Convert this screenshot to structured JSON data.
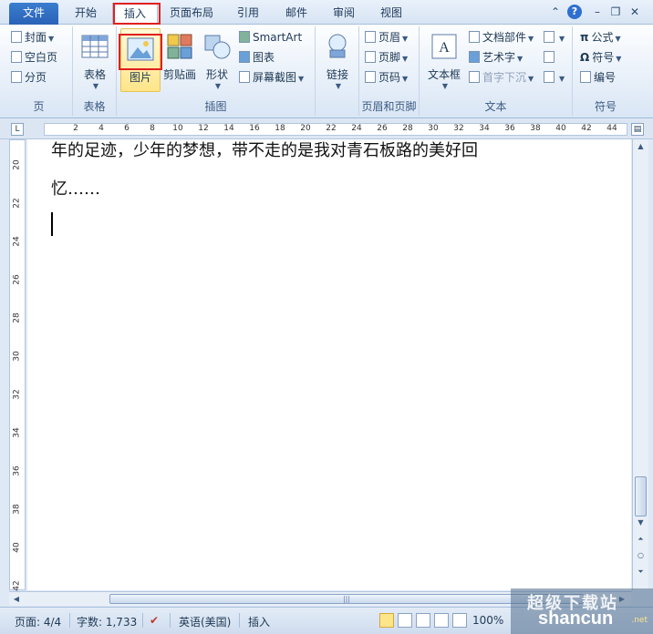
{
  "tabs": [
    {
      "label": "文件"
    },
    {
      "label": "开始"
    },
    {
      "label": "插入"
    },
    {
      "label": "页面布局"
    },
    {
      "label": "引用"
    },
    {
      "label": "邮件"
    },
    {
      "label": "审阅"
    },
    {
      "label": "视图"
    }
  ],
  "window_controls": {
    "help": "?"
  },
  "ribbon": {
    "pages": {
      "label": "页",
      "items": [
        "封面",
        "空白页",
        "分页"
      ]
    },
    "tables": {
      "label": "表格",
      "button": "表格"
    },
    "illustrations": {
      "label": "插图",
      "picture": "图片",
      "clipart": "剪贴画",
      "shapes": "形状",
      "smartart": "SmartArt",
      "chart": "图表",
      "screenshot": "屏幕截图"
    },
    "links": {
      "label": "",
      "button": "链接"
    },
    "header_footer": {
      "label": "页眉和页脚",
      "items": [
        "页眉",
        "页脚",
        "页码"
      ]
    },
    "text": {
      "label": "文本",
      "textbox": "文本框",
      "quickparts": "文档部件",
      "wordart": "艺术字",
      "dropcap": "首字下沉"
    },
    "symbols": {
      "label": "符号",
      "items": [
        "公式",
        "符号",
        "编号"
      ]
    }
  },
  "ruler": {
    "numbers": [
      "2",
      "4",
      "6",
      "8",
      "10",
      "12",
      "14",
      "16",
      "18",
      "20",
      "22",
      "24",
      "26",
      "28",
      "30",
      "32",
      "34",
      "36",
      "38",
      "40",
      "42",
      "44"
    ]
  },
  "vruler": {
    "numbers": [
      "20",
      "22",
      "24",
      "26",
      "28",
      "30",
      "32",
      "34",
      "36",
      "38",
      "40",
      "42"
    ]
  },
  "document": {
    "lines": [
      "年的足迹，少年的梦想，带不走的是我对青石板路的美好回",
      "忆……"
    ]
  },
  "status": {
    "page": "页面: 4/4",
    "words": "字数: 1,733",
    "language": "英语(美国)",
    "mode": "插入",
    "zoom": "100%"
  },
  "watermark": {
    "line1": "超级下载站",
    "line2": "shancun",
    "line3": ".net"
  }
}
